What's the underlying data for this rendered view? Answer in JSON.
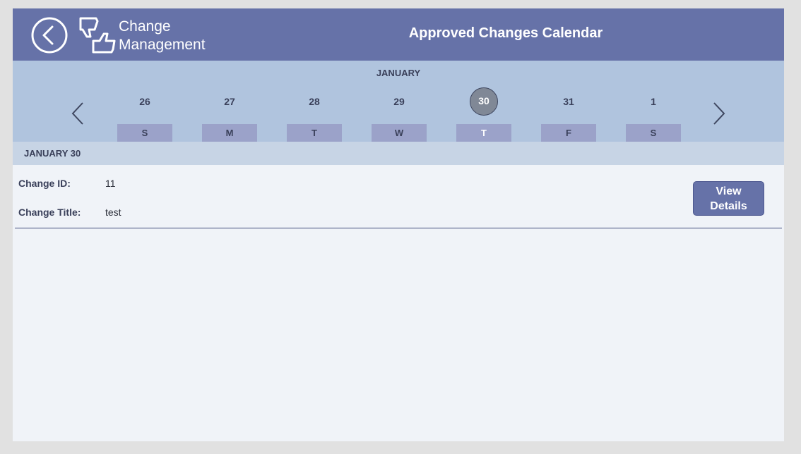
{
  "header": {
    "back_icon": "chevron-left-circle-icon",
    "logo_icon": "thumbs-up-down-icon",
    "app_name_line1": "Change",
    "app_name_line2": "Management",
    "page_title": "Approved Changes Calendar"
  },
  "calendar": {
    "month": "JANUARY",
    "prev_icon": "chevron-left-icon",
    "next_icon": "chevron-right-icon",
    "days": [
      {
        "num": "26",
        "letter": "S",
        "selected": false
      },
      {
        "num": "27",
        "letter": "M",
        "selected": false
      },
      {
        "num": "28",
        "letter": "T",
        "selected": false
      },
      {
        "num": "29",
        "letter": "W",
        "selected": false
      },
      {
        "num": "30",
        "letter": "T",
        "selected": true
      },
      {
        "num": "31",
        "letter": "F",
        "selected": false
      },
      {
        "num": "1",
        "letter": "S",
        "selected": false
      }
    ]
  },
  "selected_date_label": "JANUARY 30",
  "changes": [
    {
      "id_label": "Change ID:",
      "id_value": "11",
      "title_label": "Change Title:",
      "title_value": "test",
      "button_label": "View Details"
    }
  ],
  "colors": {
    "header": "#6672a8",
    "week_band": "#b0c4de",
    "date_bar": "#c7d4e5",
    "content_bg": "#f0f3f8",
    "day_letter_bg": "#9ba2c9",
    "selected_day": "#808896"
  }
}
